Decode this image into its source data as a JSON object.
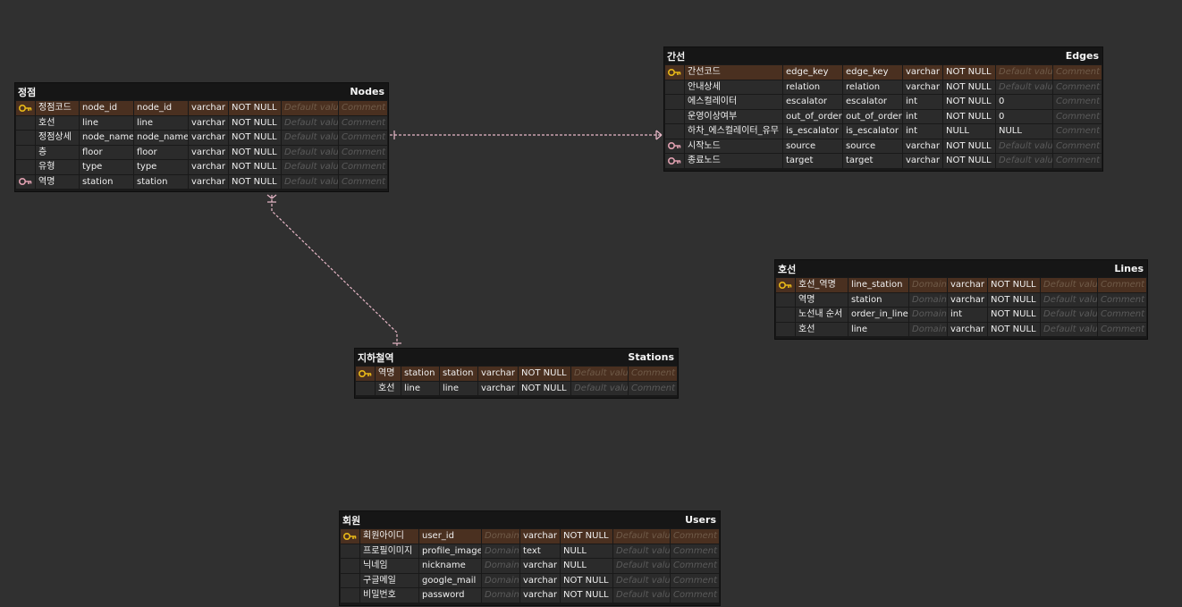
{
  "tables": [
    {
      "id": "nodes",
      "logical": "정점",
      "physical": "Nodes",
      "columns": [
        {
          "key": "pk",
          "logical": "정점코드",
          "physical": "node_id",
          "name": "node_id",
          "type": "varchar",
          "nullable": "NOT NULL",
          "default": "Default value",
          "comment": "Comment"
        },
        {
          "key": "",
          "logical": "호선",
          "physical": "line",
          "name": "line",
          "type": "varchar",
          "nullable": "NOT NULL",
          "default": "Default value",
          "comment": "Comment"
        },
        {
          "key": "",
          "logical": "정점상세",
          "physical": "node_name",
          "name": "node_name",
          "type": "varchar",
          "nullable": "NOT NULL",
          "default": "Default value",
          "comment": "Comment"
        },
        {
          "key": "",
          "logical": "층",
          "physical": "floor",
          "name": "floor",
          "type": "varchar",
          "nullable": "NOT NULL",
          "default": "Default value",
          "comment": "Comment"
        },
        {
          "key": "",
          "logical": "유형",
          "physical": "type",
          "name": "type",
          "type": "varchar",
          "nullable": "NOT NULL",
          "default": "Default value",
          "comment": "Comment"
        },
        {
          "key": "fk",
          "logical": "역명",
          "physical": "station",
          "name": "station",
          "type": "varchar",
          "nullable": "NOT NULL",
          "default": "Default value",
          "comment": "Comment"
        }
      ]
    },
    {
      "id": "edges",
      "logical": "간선",
      "physical": "Edges",
      "columns": [
        {
          "key": "pk",
          "logical": "간선코드",
          "physical": "edge_key",
          "name": "edge_key",
          "type": "varchar",
          "nullable": "NOT NULL",
          "default": "Default value",
          "comment": "Comment"
        },
        {
          "key": "",
          "logical": "안내상세",
          "physical": "relation",
          "name": "relation",
          "type": "varchar",
          "nullable": "NOT NULL",
          "default": "Default value",
          "comment": "Comment"
        },
        {
          "key": "",
          "logical": "에스컬레이터",
          "physical": "escalator",
          "name": "escalator",
          "type": "int",
          "nullable": "NOT NULL",
          "default": "0",
          "comment": "Comment"
        },
        {
          "key": "",
          "logical": "운영이상여부",
          "physical": "out_of_order",
          "name": "out_of_order",
          "type": "int",
          "nullable": "NOT NULL",
          "default": "0",
          "comment": "Comment"
        },
        {
          "key": "",
          "logical": "하차_에스컬레이터_유무",
          "physical": "is_escalator",
          "name": "is_escalator",
          "type": "int",
          "nullable": "NULL",
          "default": "NULL",
          "comment": "Comment"
        },
        {
          "key": "fk",
          "logical": "시작노드",
          "physical": "source",
          "name": "source",
          "type": "varchar",
          "nullable": "NOT NULL",
          "default": "Default value",
          "comment": "Comment"
        },
        {
          "key": "fk",
          "logical": "종료노드",
          "physical": "target",
          "name": "target",
          "type": "varchar",
          "nullable": "NOT NULL",
          "default": "Default value",
          "comment": "Comment"
        }
      ]
    },
    {
      "id": "lines",
      "logical": "호선",
      "physical": "Lines",
      "columns": [
        {
          "key": "pk",
          "logical": "호선_역명",
          "physical": "line_station",
          "domain": "Domain",
          "type": "varchar",
          "nullable": "NOT NULL",
          "default": "Default value",
          "comment": "Comment"
        },
        {
          "key": "",
          "logical": "역명",
          "physical": "station",
          "domain": "Domain",
          "type": "varchar",
          "nullable": "NOT NULL",
          "default": "Default value",
          "comment": "Comment"
        },
        {
          "key": "",
          "logical": "노선내 순서",
          "physical": "order_in_line",
          "domain": "Domain",
          "type": "int",
          "nullable": "NOT NULL",
          "default": "Default value",
          "comment": "Comment"
        },
        {
          "key": "",
          "logical": "호선",
          "physical": "line",
          "domain": "Domain",
          "type": "varchar",
          "nullable": "NOT NULL",
          "default": "Default value",
          "comment": "Comment"
        }
      ]
    },
    {
      "id": "stations",
      "logical": "지하철역",
      "physical": "Stations",
      "columns": [
        {
          "key": "pk",
          "logical": "역명",
          "physical": "station",
          "name": "station",
          "type": "varchar",
          "nullable": "NOT NULL",
          "default": "Default value",
          "comment": "Comment"
        },
        {
          "key": "",
          "logical": "호선",
          "physical": "line",
          "name": "line",
          "type": "varchar",
          "nullable": "NOT NULL",
          "default": "Default value",
          "comment": "Comment"
        }
      ]
    },
    {
      "id": "users",
      "logical": "회원",
      "physical": "Users",
      "columns": [
        {
          "key": "pk",
          "logical": "회원아이디",
          "physical": "user_id",
          "domain": "Domain",
          "type": "varchar",
          "nullable": "NOT NULL",
          "default": "Default value",
          "comment": "Comment"
        },
        {
          "key": "",
          "logical": "프로필이미지",
          "physical": "profile_image",
          "domain": "Domain",
          "type": "text",
          "nullable": "NULL",
          "default": "Default value",
          "comment": "Comment"
        },
        {
          "key": "",
          "logical": "닉네임",
          "physical": "nickname",
          "domain": "Domain",
          "type": "varchar",
          "nullable": "NULL",
          "default": "Default value",
          "comment": "Comment"
        },
        {
          "key": "",
          "logical": "구글메일",
          "physical": "google_mail",
          "domain": "Domain",
          "type": "varchar",
          "nullable": "NOT NULL",
          "default": "Default value",
          "comment": "Comment"
        },
        {
          "key": "",
          "logical": "비밀번호",
          "physical": "password",
          "domain": "Domain",
          "type": "varchar",
          "nullable": "NOT NULL",
          "default": "Default value",
          "comment": "Comment"
        }
      ]
    }
  ],
  "relations": [
    {
      "from": "nodes",
      "to": "edges"
    },
    {
      "from": "nodes",
      "to": "stations"
    }
  ],
  "colors": {
    "canvas": "#303030",
    "pk_row": "#4a3020",
    "pk_icon": "#e8b818",
    "fk_icon": "#e0a0b0",
    "relation_line": "#e8b8c8"
  }
}
